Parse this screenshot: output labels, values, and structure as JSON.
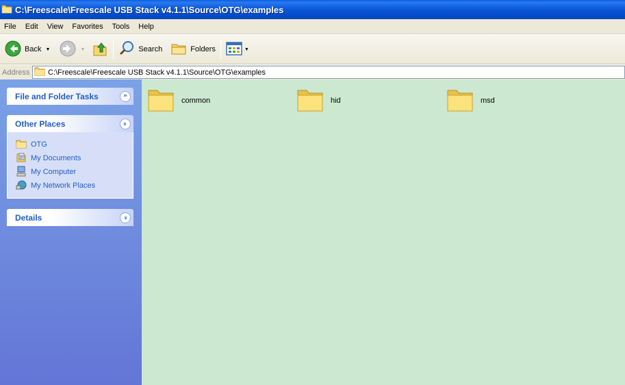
{
  "window": {
    "title": "C:\\Freescale\\Freescale USB Stack v4.1.1\\Source\\OTG\\examples"
  },
  "menu": [
    "File",
    "Edit",
    "View",
    "Favorites",
    "Tools",
    "Help"
  ],
  "toolbar": {
    "back_label": "Back",
    "search_label": "Search",
    "folders_label": "Folders"
  },
  "address": {
    "label": "Address",
    "value": "C:\\Freescale\\Freescale USB Stack v4.1.1\\Source\\OTG\\examples"
  },
  "tasks": {
    "file_folder_tasks": "File and Folder Tasks",
    "other_places": "Other Places",
    "places": [
      "OTG",
      "My Documents",
      "My Computer",
      "My Network Places"
    ],
    "details": "Details"
  },
  "folders": [
    "common",
    "hid",
    "msd"
  ],
  "colors": {
    "titlebar": "#0b5ad8",
    "content_bg": "#cce8d0",
    "task_link": "#215dc6"
  }
}
